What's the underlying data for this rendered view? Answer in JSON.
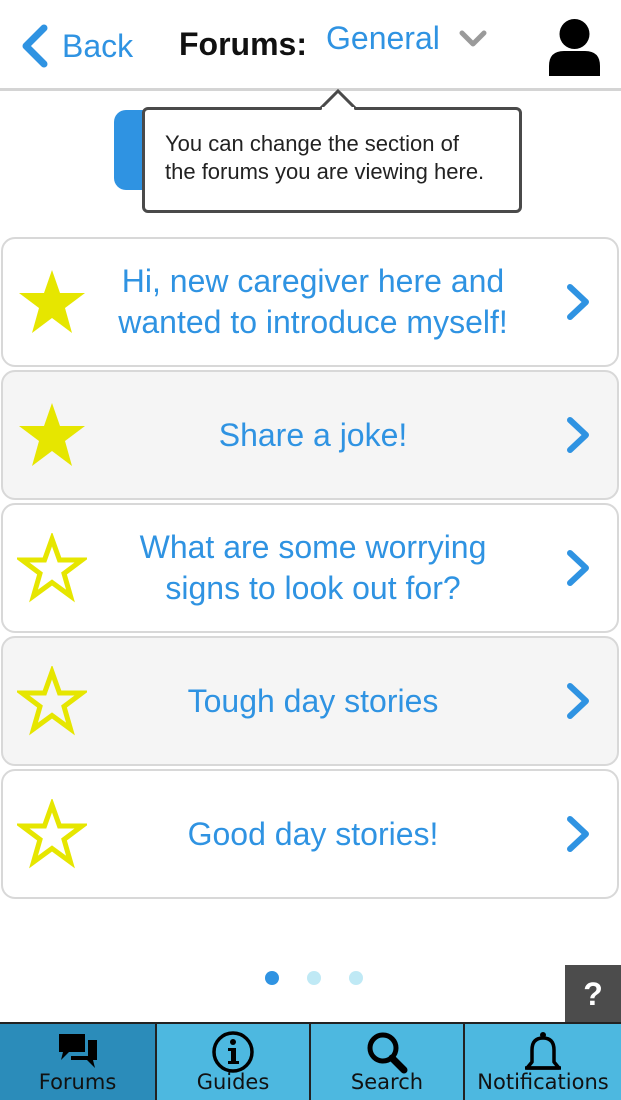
{
  "header": {
    "back_label": "Back",
    "forums_label": "Forums:",
    "section_value": "General",
    "back_icon": "chevron-left-icon",
    "dropdown_icon": "chevron-down-icon",
    "user_icon": "user-icon"
  },
  "tooltip": {
    "text_line1": "You can change the section of",
    "text_line2": "the forums you are viewing here."
  },
  "threads": [
    {
      "title_line1": "Hi, new caregiver here and",
      "title_line2": "wanted to introduce myself!",
      "starred": true
    },
    {
      "title_line1": "Share a joke!",
      "title_line2": "",
      "starred": true
    },
    {
      "title_line1": "What are some worrying",
      "title_line2": "signs to look out for?",
      "starred": false
    },
    {
      "title_line1": "Tough day stories",
      "title_line2": "",
      "starred": false
    },
    {
      "title_line1": "Good day stories!",
      "title_line2": "",
      "starred": false
    }
  ],
  "pager": {
    "pages": 3,
    "current": 1
  },
  "help_label": "?",
  "tabs": [
    {
      "label": "Forums",
      "icon": "chat-icon",
      "active": true
    },
    {
      "label": "Guides",
      "icon": "info-icon",
      "active": false
    },
    {
      "label": "Search",
      "icon": "search-icon",
      "active": false
    },
    {
      "label": "Notifications",
      "icon": "bell-icon",
      "active": false
    }
  ],
  "colors": {
    "accent": "#2f93e2",
    "star": "#e6e600",
    "tabbar": "#4db8e0",
    "tab_active": "#2b8cba",
    "dot_active": "#2f93e2",
    "dot_inactive": "#bfe9f5"
  }
}
